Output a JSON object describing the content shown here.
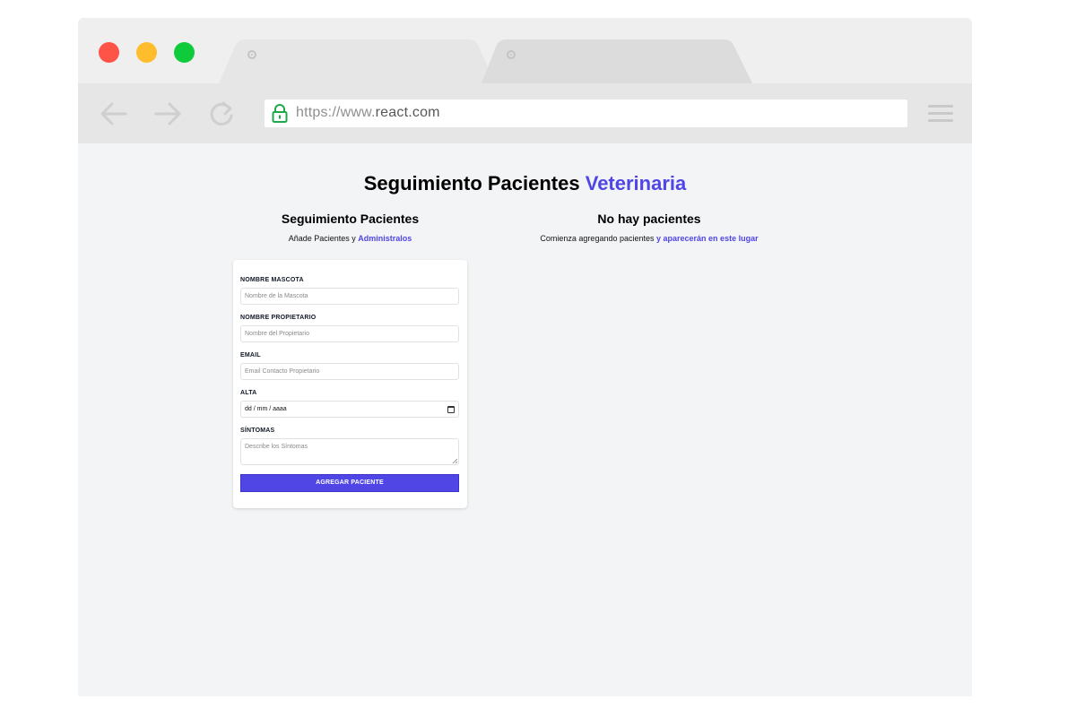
{
  "browser": {
    "url_scheme": "https://www.",
    "url_host": "react.com"
  },
  "colors": {
    "accent": "#4f46e5",
    "close_dot": "#fe5347",
    "minimize_dot": "#ffbd2e",
    "maximize_dot": "#0fcb3c"
  },
  "header": {
    "title_main": "Seguimiento Pacientes",
    "title_accent": "Veterinaria"
  },
  "form_section": {
    "title": "Seguimiento Pacientes",
    "subtitle_text": "Añade Pacientes y",
    "subtitle_accent": "Administralos"
  },
  "list_section": {
    "title": "No hay pacientes",
    "subtitle_text": "Comienza agregando pacientes",
    "subtitle_accent": "y aparecerán en este lugar"
  },
  "form": {
    "pet_name": {
      "label": "NOMBRE MASCOTA",
      "placeholder": "Nombre de la Mascota"
    },
    "owner_name": {
      "label": "NOMBRE PROPIETARIO",
      "placeholder": "Nombre del Propietario"
    },
    "email": {
      "label": "EMAIL",
      "placeholder": "Email Contacto Propietario"
    },
    "date": {
      "label": "ALTA",
      "value": "dd / mm / aaaa"
    },
    "symptoms": {
      "label": "SÍNTOMAS",
      "placeholder": "Describe los Síntomas"
    },
    "submit_label": "AGREGAR PACIENTE"
  }
}
